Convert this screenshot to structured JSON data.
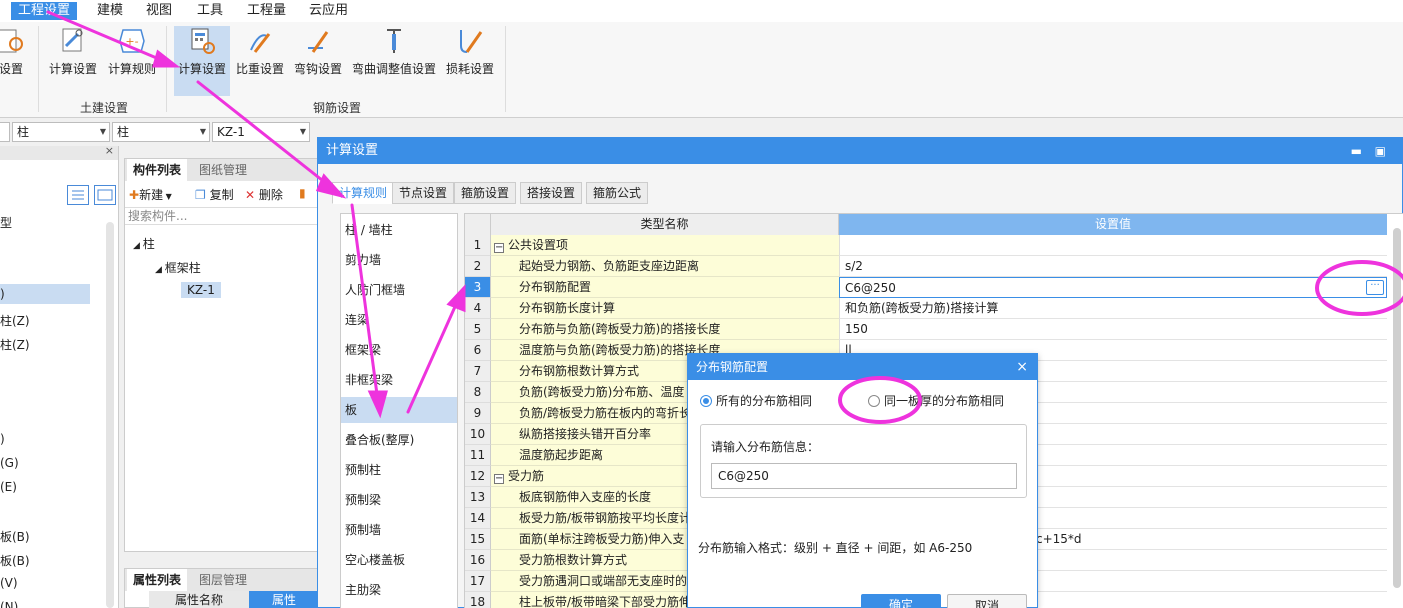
{
  "colors": {
    "accent": "#3a8ee6",
    "annotation": "#ee33dd",
    "row_yellow": "#fdfdd8",
    "selected": "#c9dcf2"
  },
  "menubar": {
    "items": [
      {
        "label": "工程设置",
        "active": true
      },
      {
        "label": "建模"
      },
      {
        "label": "视图"
      },
      {
        "label": "工具"
      },
      {
        "label": "工程量"
      },
      {
        "label": "云应用"
      }
    ]
  },
  "ribbon": {
    "partial_label": "设置",
    "buttons": [
      {
        "label": "计算设置",
        "icon": "calc-settings-icon"
      },
      {
        "label": "计算规则",
        "icon": "calc-rules-icon"
      },
      {
        "label": "计算设置",
        "icon": "rebar-calc-settings-icon"
      },
      {
        "label": "比重设置",
        "icon": "density-settings-icon"
      },
      {
        "label": "弯钩设置",
        "icon": "hook-settings-icon"
      },
      {
        "label": "弯曲调整值设置",
        "icon": "bend-adjust-icon"
      },
      {
        "label": "损耗设置",
        "icon": "loss-settings-icon"
      }
    ],
    "groups": [
      "土建设置",
      "钢筋设置"
    ]
  },
  "selectors": [
    "柱",
    "柱",
    "KZ-1"
  ],
  "left_panel": {
    "items": [
      "型",
      ")",
      "柱(Z)",
      "柱(Z)",
      ")",
      "(G)",
      "(E)",
      "板(B)",
      "板(B)",
      "(V)",
      "(N)"
    ]
  },
  "component_panel": {
    "tabs": [
      "构件列表",
      "图纸管理"
    ],
    "toolbar": {
      "new": "新建",
      "copy": "复制",
      "delete": "删除"
    },
    "search_placeholder": "搜索构件...",
    "tree": [
      "柱",
      "框架柱",
      "KZ-1"
    ]
  },
  "property_panel": {
    "tabs": [
      "属性列表",
      "图层管理"
    ],
    "headers": [
      "属性名称",
      "属性"
    ]
  },
  "dialog": {
    "title": "计算设置",
    "tabs": [
      "计算规则",
      "节点设置",
      "箍筋设置",
      "搭接设置",
      "箍筋公式"
    ],
    "categories": [
      "柱 / 墙柱",
      "剪力墙",
      "人防门框墙",
      "连梁",
      "框架梁",
      "非框架梁",
      "板",
      "叠合板(整厚)",
      "预制柱",
      "预制梁",
      "预制墙",
      "空心楼盖板",
      "主肋梁"
    ],
    "selected_category": "板",
    "grid_headers": [
      "类型名称",
      "设置值"
    ],
    "rows": [
      {
        "n": "1",
        "name": "公共设置项",
        "value": "",
        "group": true
      },
      {
        "n": "2",
        "name": "起始受力钢筋、负筋距支座边距离",
        "value": "s/2"
      },
      {
        "n": "3",
        "name": "分布钢筋配置",
        "value": "C6@250",
        "active": true
      },
      {
        "n": "4",
        "name": "分布钢筋长度计算",
        "value": "和负筋(跨板受力筋)搭接计算"
      },
      {
        "n": "5",
        "name": "分布筋与负筋(跨板受力筋)的搭接长度",
        "value": "150"
      },
      {
        "n": "6",
        "name": "温度筋与负筋(跨板受力筋)的搭接长度",
        "value": "ll"
      },
      {
        "n": "7",
        "name": "分布钢筋根数计算方式",
        "value": ""
      },
      {
        "n": "8",
        "name": "负筋(跨板受力筋)分布筋、温度",
        "value": ""
      },
      {
        "n": "9",
        "name": "负筋/跨板受力筋在板内的弯折长",
        "value": ""
      },
      {
        "n": "10",
        "name": "纵筋搭接接头错开百分率",
        "value": ""
      },
      {
        "n": "11",
        "name": "温度筋起步距离",
        "value": ""
      },
      {
        "n": "12",
        "name": "受力筋",
        "value": "",
        "group": true
      },
      {
        "n": "13",
        "name": "板底钢筋伸入支座的长度",
        "value": ""
      },
      {
        "n": "14",
        "name": "板受力筋/板带钢筋按平均长度计",
        "value": ""
      },
      {
        "n": "15",
        "name": "面筋(单标注跨板受力筋)伸入支",
        "value": "c+15*d"
      },
      {
        "n": "16",
        "name": "受力筋根数计算方式",
        "value": ""
      },
      {
        "n": "17",
        "name": "受力筋遇洞口或端部无支座时的",
        "value": ""
      },
      {
        "n": "18",
        "name": "柱上板带/板带暗梁下部受力筋伸",
        "value": ""
      }
    ]
  },
  "popup": {
    "title": "分布钢筋配置",
    "radio_all": "所有的分布筋相同",
    "radio_same_thickness": "同一板厚的分布筋相同",
    "input_label": "请输入分布筋信息：",
    "input_value": "C6@250",
    "hint": "分布筋输入格式：级别 + 直径 + 间距，如 A6-250",
    "ok": "确定",
    "cancel": "取消"
  }
}
